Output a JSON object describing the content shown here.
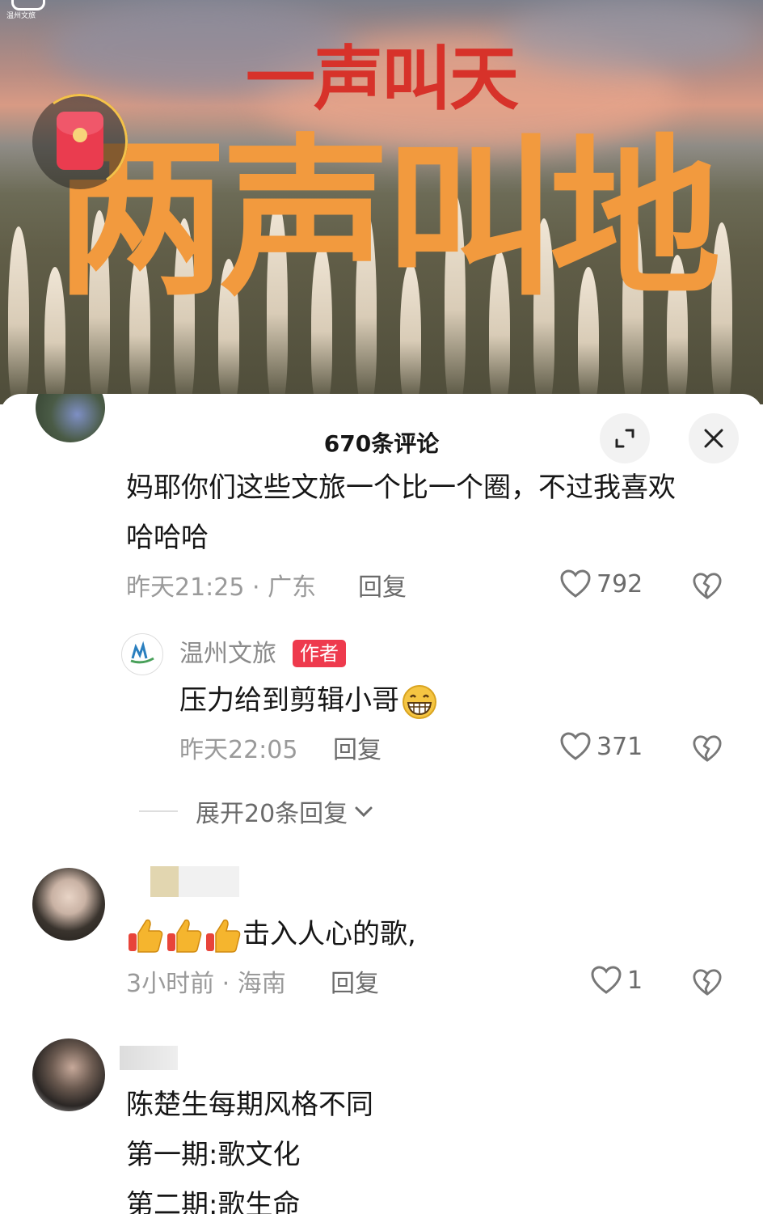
{
  "video": {
    "logo_text": "温州文旅",
    "title_line1": "一声叫天",
    "title_line2": "两声叫地"
  },
  "sheet": {
    "title": "670条评论",
    "icons": {
      "expand": "expand-icon",
      "close": "close-icon"
    }
  },
  "comments": [
    {
      "text_lines": [
        "妈耶你们这些文旅一个比一个圈，不过我喜欢",
        "哈哈哈"
      ],
      "meta": "昨天21:25 · 广东",
      "reply_label": "回复",
      "likes": "792"
    },
    {
      "username": "",
      "text": "击入人心的歌,",
      "meta": "3小时前 · 海南",
      "reply_label": "回复",
      "likes": "1"
    },
    {
      "username": "",
      "text_lines": [
        "陈楚生每期风格不同",
        "第一期:歌文化",
        "第二期:歌生命"
      ]
    }
  ],
  "author_reply": {
    "username": "温州文旅",
    "badge": "作者",
    "text": "压力给到剪辑小哥",
    "emoji": "grinning-face-icon",
    "meta": "昨天22:05",
    "reply_label": "回复",
    "likes": "371"
  },
  "expand_replies": {
    "label": "展开20条回复"
  },
  "colors": {
    "accent_red": "#ee3a4d",
    "title_orange": "#f29a3e",
    "title_red": "#d7322a"
  }
}
